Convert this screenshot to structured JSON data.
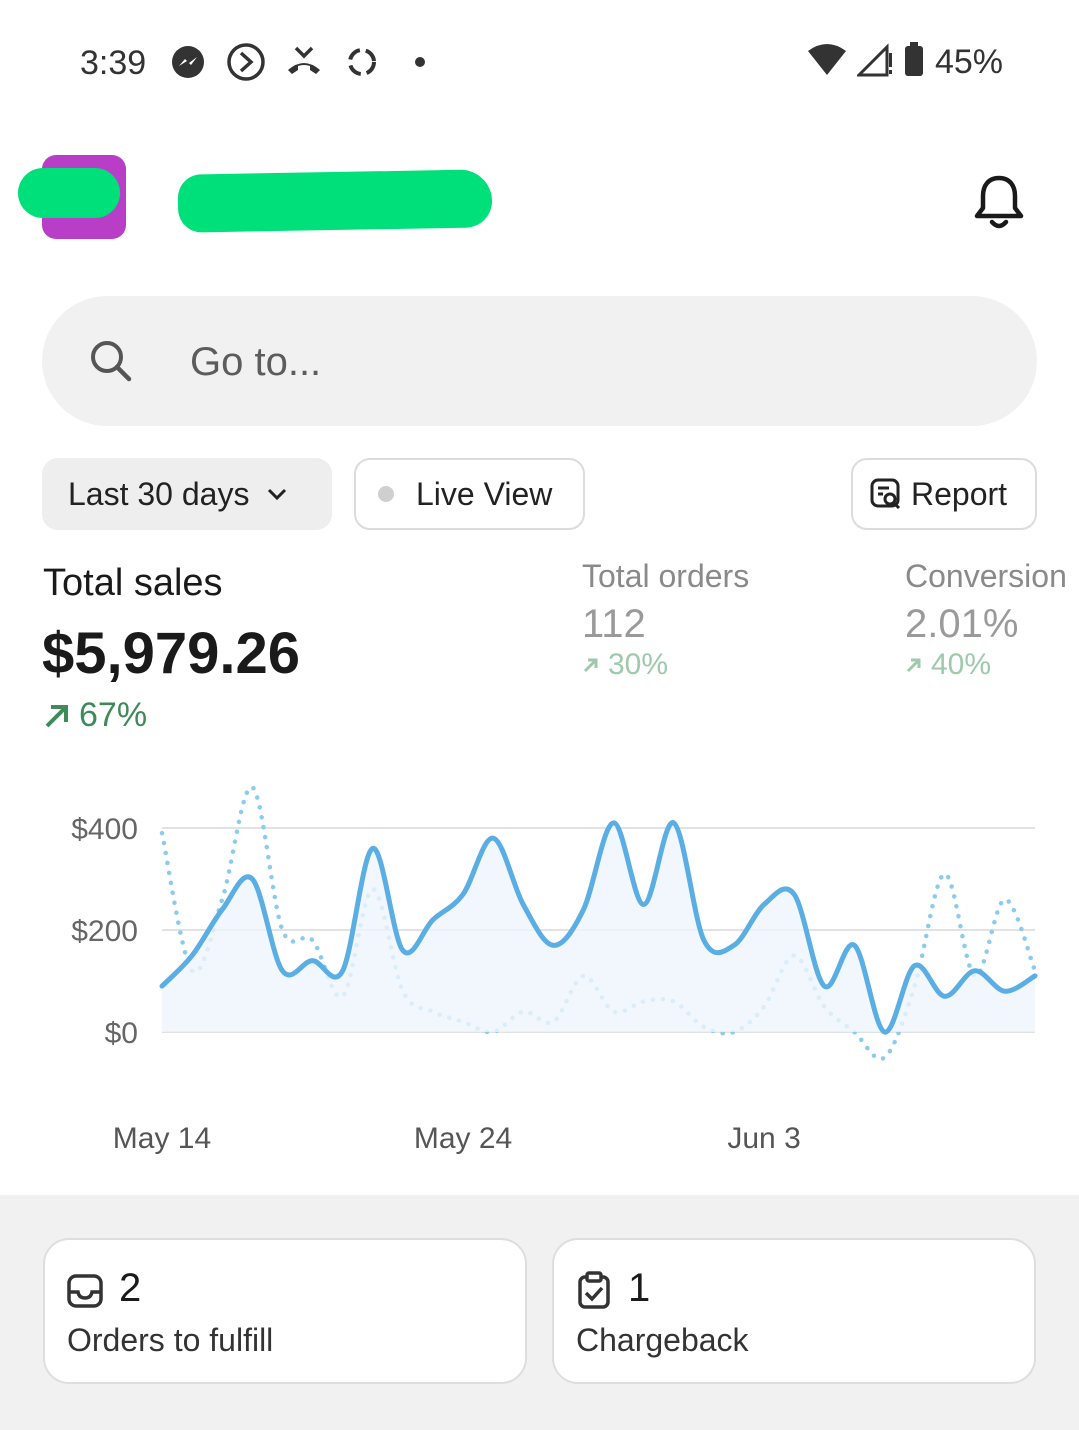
{
  "status_bar": {
    "time": "3:39",
    "battery": "45%",
    "icons": [
      "messenger-icon",
      "call-forward-icon",
      "missed-call-icon",
      "sync-icon",
      "dot-icon",
      "wifi-icon",
      "signal-icon",
      "battery-icon"
    ]
  },
  "header": {
    "store_name": "",
    "icons": [
      "store-avatar",
      "bell-icon"
    ]
  },
  "search": {
    "placeholder": "Go to..."
  },
  "filters": {
    "range_label": "Last 30 days",
    "live_label": "Live View",
    "report_label": "Report"
  },
  "metrics": {
    "total_sales": {
      "title": "Total sales",
      "value": "$5,979.26",
      "change": "67%"
    },
    "total_orders": {
      "title": "Total orders",
      "value": "112",
      "change": "30%"
    },
    "conversion": {
      "title": "Conversion",
      "value": "2.01%",
      "change": "40%"
    }
  },
  "chart_data": {
    "type": "line",
    "y_ticks": [
      "$400",
      "$200",
      "$0"
    ],
    "x_ticks": [
      "May 14",
      "May 24",
      "Jun 3"
    ],
    "ylim": [
      0,
      400
    ],
    "grid": true,
    "x_count": 30,
    "series": [
      {
        "style": "solid",
        "color": "#5aaee3",
        "values": [
          90,
          150,
          240,
          300,
          120,
          140,
          120,
          360,
          160,
          220,
          270,
          380,
          250,
          170,
          240,
          410,
          250,
          410,
          180,
          170,
          250,
          270,
          90,
          170,
          0,
          130,
          70,
          120,
          80,
          110
        ]
      },
      {
        "style": "dotted",
        "color": "#8ccbee",
        "values": [
          390,
          120,
          260,
          480,
          200,
          180,
          70,
          280,
          80,
          40,
          20,
          0,
          40,
          20,
          110,
          40,
          60,
          60,
          10,
          0,
          50,
          150,
          50,
          0,
          -50,
          90,
          310,
          110,
          260,
          120
        ]
      }
    ]
  },
  "tasks": [
    {
      "count": "2",
      "label": "Orders to fulfill",
      "icon": "inbox-icon"
    },
    {
      "count": "1",
      "label": "Chargeback",
      "icon": "clipboard-check-icon"
    }
  ]
}
